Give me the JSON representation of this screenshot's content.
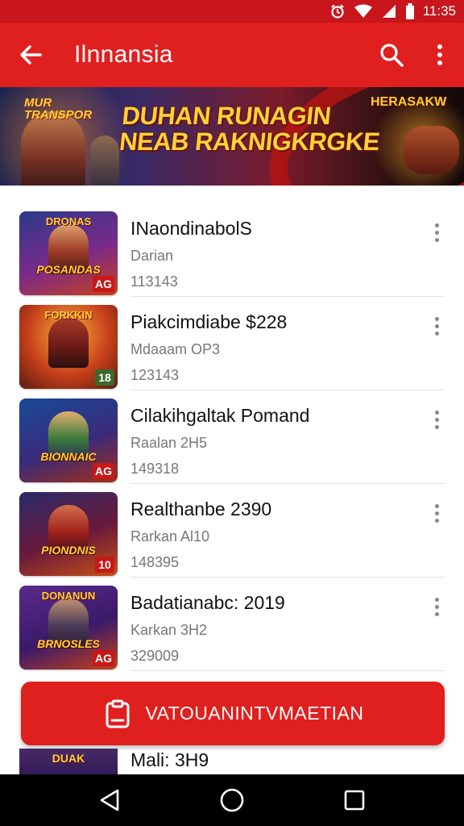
{
  "status_bar": {
    "time": "11:35"
  },
  "app_bar": {
    "title": "Ilnnansia"
  },
  "banner": {
    "mini_logo": "MUR TRANSPOR",
    "headline_line1": "DUHAN RUNAGIN",
    "headline_line2": "NEAB RAKNIGKRGKE",
    "right_tag": "HERASAKW"
  },
  "games": [
    {
      "name": "INaondinabolS",
      "subtitle": "Darian",
      "meta": "113143",
      "thumb_top": "DRONAS",
      "thumb_logo": "POSANDAS",
      "age": "AG",
      "colors": [
        "#2b3a8a",
        "#7a2a8a",
        "#c8401a"
      ]
    },
    {
      "name": "Piakcimdiabe $228",
      "subtitle": "Mdaaam OP3",
      "meta": "123143",
      "thumb_top": "FORKKIN",
      "thumb_logo": "",
      "age": "18",
      "colors": [
        "#f0a030",
        "#c8401a",
        "#5a1a10"
      ]
    },
    {
      "name": "Cilakihgaltak Pomand",
      "subtitle": "Raalan 2H5",
      "meta": "149318",
      "thumb_top": "",
      "thumb_logo": "BIONNAIC",
      "age": "AG",
      "colors": [
        "#1a4a9a",
        "#3a2a7a",
        "#a0301a"
      ]
    },
    {
      "name": "Realthanbe 2390",
      "subtitle": "Rarkan Al10",
      "meta": "148395",
      "thumb_top": "",
      "thumb_logo": "PIONDNIS",
      "age": "10",
      "colors": [
        "#2a2a6a",
        "#6a1a3a",
        "#c8501a"
      ]
    },
    {
      "name": "Badatianabc: 2019",
      "subtitle": "Karkan 3H2",
      "meta": "329009",
      "thumb_top": "DONANUN",
      "thumb_logo": "BRNOSLES",
      "age": "AG",
      "colors": [
        "#5a2a8a",
        "#3a1a6a",
        "#c8401a"
      ]
    }
  ],
  "cta": {
    "label": "VATOUANINTVMAETIAN"
  },
  "partial_row": {
    "name": "Mali: 3H9",
    "thumb_top": "DUAK"
  },
  "theme": {
    "primary": "#e0201f",
    "status": "#c8161c"
  }
}
